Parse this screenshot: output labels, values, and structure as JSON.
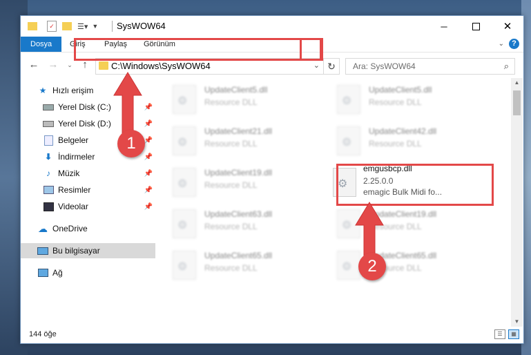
{
  "window": {
    "title": "SysWOW64"
  },
  "ribbon": {
    "tabs": [
      "Dosya",
      "Giriş",
      "Paylaş",
      "Görünüm"
    ],
    "help": "?"
  },
  "nav": {
    "address": "C:\\Windows\\SysWOW64",
    "search_placeholder": "Ara: SysWOW64"
  },
  "sidebar": {
    "items": [
      {
        "label": "Hızlı erişim",
        "icon": "star-icon"
      },
      {
        "label": "Yerel Disk (C:)",
        "icon": "drive-icon"
      },
      {
        "label": "Yerel Disk (D:)",
        "icon": "drive-icon"
      },
      {
        "label": "Belgeler",
        "icon": "documents-icon"
      },
      {
        "label": "İndirmeler",
        "icon": "download-icon"
      },
      {
        "label": "Müzik",
        "icon": "music-icon"
      },
      {
        "label": "Resimler",
        "icon": "pictures-icon"
      },
      {
        "label": "Videolar",
        "icon": "videos-icon"
      },
      {
        "label": "OneDrive",
        "icon": "cloud-icon"
      },
      {
        "label": "Bu bilgisayar",
        "icon": "computer-icon"
      },
      {
        "label": "Ağ",
        "icon": "network-icon"
      }
    ]
  },
  "files": [
    {
      "name": "UpdateClient5.dll",
      "desc": "Resource DLL"
    },
    {
      "name": "UpdateClient5.dll",
      "desc": "Resource DLL"
    },
    {
      "name": "UpdateClient21.dll",
      "desc": "Resource DLL"
    },
    {
      "name": "UpdateClient42.dll",
      "desc": "Resource DLL"
    },
    {
      "name": "UpdateClient19.dll",
      "desc": "Resource DLL"
    },
    {
      "name": "emgusbcp.dll",
      "desc": "2.25.0.0",
      "desc2": "emagic Bulk Midi fo..."
    },
    {
      "name": "UpdateClient63.dll",
      "desc": "Resource DLL"
    },
    {
      "name": "UpdateClient19.dll",
      "desc": "Resource DLL"
    },
    {
      "name": "UpdateClient65.dll",
      "desc": "Resource DLL"
    },
    {
      "name": "UpdateClient65.dll",
      "desc": "Resource DLL"
    }
  ],
  "status": {
    "count": "144 öğe"
  },
  "annotations": {
    "step1": "1",
    "step2": "2"
  },
  "colors": {
    "accent": "#1979ca",
    "highlight": "#e34848"
  }
}
